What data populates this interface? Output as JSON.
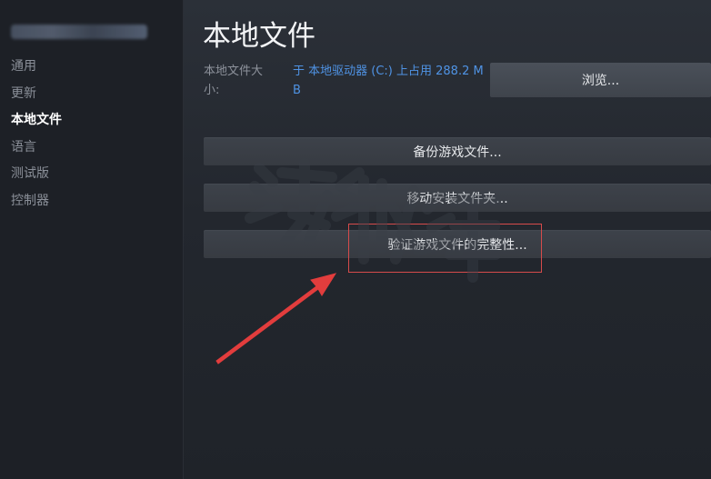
{
  "sidebar": {
    "items": [
      {
        "label": "通用",
        "active": false
      },
      {
        "label": "更新",
        "active": false
      },
      {
        "label": "本地文件",
        "active": true
      },
      {
        "label": "语言",
        "active": false
      },
      {
        "label": "测试版",
        "active": false
      },
      {
        "label": "控制器",
        "active": false
      }
    ]
  },
  "main": {
    "title": "本地文件",
    "size_label": "本地文件大小:",
    "size_value": "于 本地驱动器 (C:) 上占用 288.2 MB",
    "browse_label": "浏览...",
    "backup_label": "备份游戏文件...",
    "move_label": "移动安装文件夹...",
    "verify_label": "验证游戏文件的完整性..."
  },
  "colors": {
    "background": "#23272e",
    "sidebar": "#1d2026",
    "link": "#4f93e4",
    "button": "#3d424a",
    "highlight": "#d64b4b"
  },
  "annotation": {
    "arrow_color": "#e23d3d"
  }
}
